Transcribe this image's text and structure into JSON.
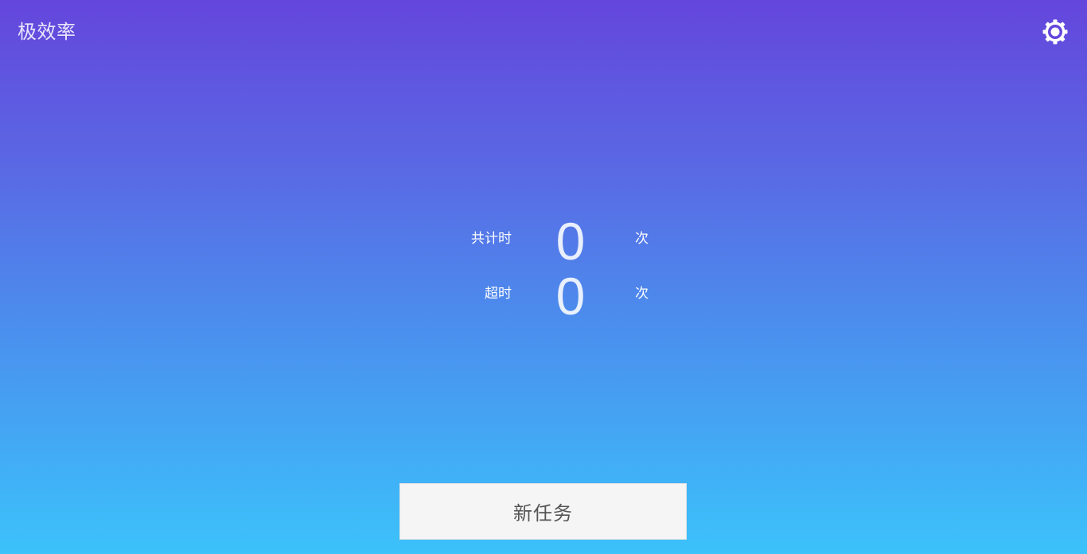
{
  "app": {
    "title": "极效率"
  },
  "header": {
    "settings_icon": "gear-icon"
  },
  "stats": {
    "total": {
      "label": "共计时",
      "value": "0",
      "unit": "次"
    },
    "overtime": {
      "label": "超时",
      "value": "0",
      "unit": "次"
    }
  },
  "actions": {
    "new_task_label": "新任务"
  },
  "colors": {
    "gradient_top": "#6446dc",
    "gradient_bottom": "#3cc2fb",
    "button_bg": "#f5f5f5",
    "button_text": "#555555"
  }
}
